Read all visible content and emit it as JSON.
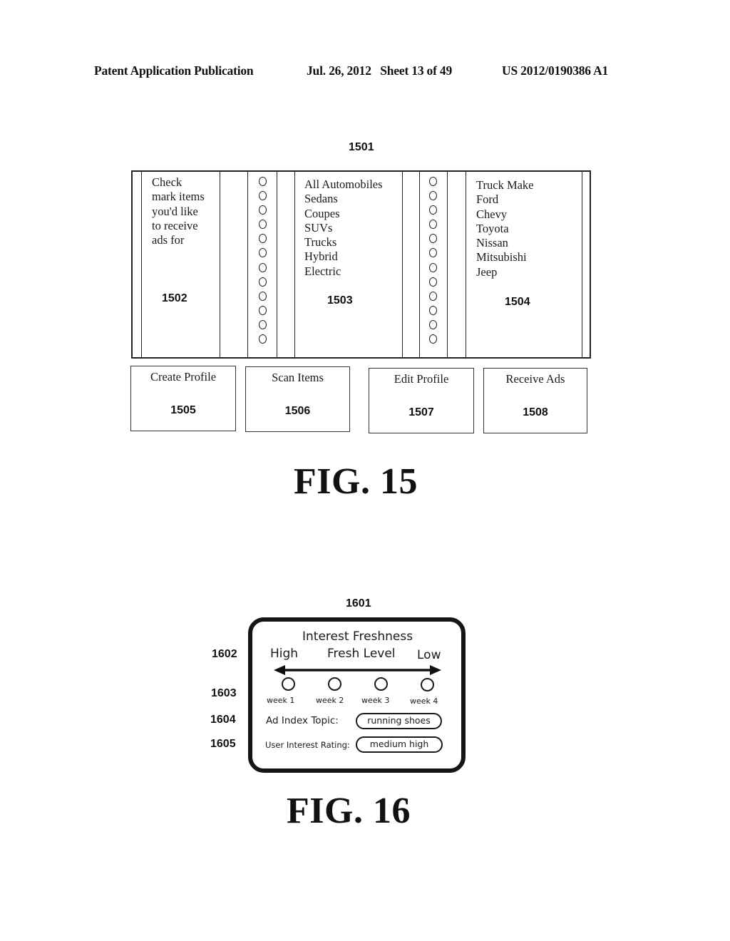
{
  "header": {
    "publication": "Patent Application Publication",
    "date_sheet": "Jul. 26, 2012   Sheet 13 of 49",
    "patent_number": "US 2012/0190386 A1"
  },
  "fig15": {
    "ref_main": "1501",
    "instructions": {
      "lines": [
        "Check",
        "mark items",
        "you'd like",
        "to receive",
        "ads for"
      ],
      "ref": "1502"
    },
    "radio_column_1": {
      "count": 12,
      "glyph": "O"
    },
    "categories": {
      "items": [
        "All Automobiles",
        "Sedans",
        "Coupes",
        "SUVs",
        "Trucks",
        "Hybrid",
        "Electric"
      ],
      "ref": "1503"
    },
    "radio_column_2": {
      "count": 12,
      "glyph": "O"
    },
    "subcategories": {
      "items": [
        "Truck Make",
        "Ford",
        "Chevy",
        "Toyota",
        "Nissan",
        "Mitsubishi",
        "Jeep"
      ],
      "ref": "1504"
    },
    "buttons": [
      {
        "label": "Create Profile",
        "ref": "1505"
      },
      {
        "label": "Scan Items",
        "ref": "1506"
      },
      {
        "label": "Edit Profile",
        "ref": "1507"
      },
      {
        "label": "Receive Ads",
        "ref": "1508"
      }
    ],
    "caption": "FIG. 15"
  },
  "fig16": {
    "ref_main": "1601",
    "title": "Interest Freshness",
    "scale": {
      "high_label": "High",
      "center_label": "Fresh Level",
      "low_label": "Low",
      "ref": "1602",
      "arrow_icon": "double-headed-arrow"
    },
    "weeks": {
      "labels": [
        "week 1",
        "week 2",
        "week 3",
        "week 4"
      ],
      "ref": "1603"
    },
    "ad_index_topic": {
      "label": "Ad Index Topic:",
      "value": "running shoes",
      "ref": "1604"
    },
    "user_interest_rating": {
      "label": "User Interest Rating:",
      "value": "medium high",
      "ref": "1605"
    },
    "caption": "FIG. 16"
  }
}
